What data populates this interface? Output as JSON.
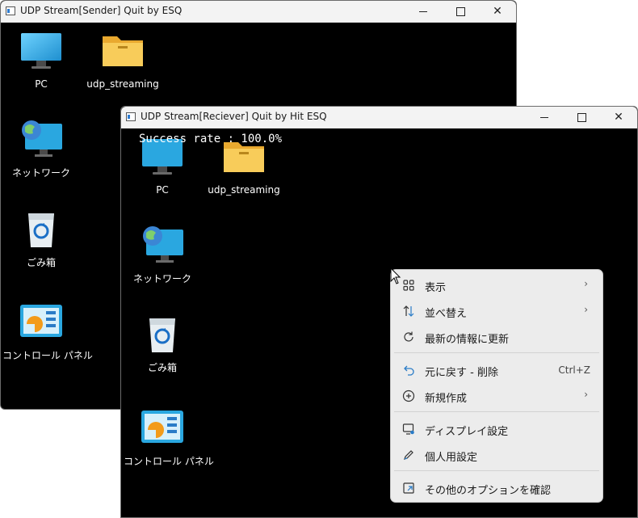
{
  "sender": {
    "title": "UDP Stream[Sender] Quit by ESQ",
    "icons": [
      {
        "label": "PC",
        "icon": "monitor-icon"
      },
      {
        "label": "udp_streaming",
        "icon": "folder-icon"
      },
      {
        "label": "ネットワーク",
        "icon": "network-icon"
      },
      {
        "label": "ごみ箱",
        "icon": "recycle-bin-icon"
      },
      {
        "label": "コントロール パネル",
        "icon": "control-panel-icon"
      }
    ]
  },
  "receiver": {
    "title": "UDP Stream[Reciever]  Quit by Hit ESQ",
    "overlay": "Success rate : 100.0%",
    "icons": [
      {
        "label": "PC",
        "icon": "monitor-icon"
      },
      {
        "label": "udp_streaming",
        "icon": "folder-icon"
      },
      {
        "label": "ネットワーク",
        "icon": "network-icon"
      },
      {
        "label": "ごみ箱",
        "icon": "recycle-bin-icon"
      },
      {
        "label": "コントロール パネル",
        "icon": "control-panel-icon"
      }
    ]
  },
  "context_menu": {
    "items": [
      {
        "label": "表示",
        "icon": "view-grid-icon",
        "submenu": true
      },
      {
        "label": "並べ替え",
        "icon": "sort-icon",
        "submenu": true
      },
      {
        "label": "最新の情報に更新",
        "icon": "refresh-icon"
      },
      {
        "label": "元に戻す - 削除",
        "icon": "undo-icon",
        "shortcut": "Ctrl+Z"
      },
      {
        "label": "新規作成",
        "icon": "new-plus-icon",
        "submenu": true
      },
      {
        "label": "ディスプレイ設定",
        "icon": "display-settings-icon"
      },
      {
        "label": "個人用設定",
        "icon": "personalize-pen-icon"
      },
      {
        "label": "その他のオプションを確認",
        "icon": "more-options-icon"
      }
    ]
  },
  "colors": {
    "desktop_bg": "#000000",
    "menu_bg": "#ececec",
    "titlebar_bg": "#f3f3f3",
    "folder_yellow": "#f6c244",
    "monitor_blue": "#2aa7e0"
  }
}
